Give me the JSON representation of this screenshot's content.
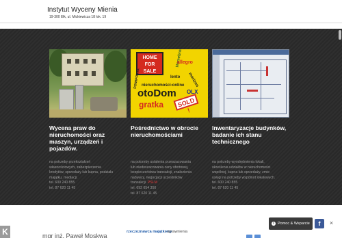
{
  "header": {
    "title": "Instytut Wyceny Mienia",
    "address": "19-300 Ełk, ul. Mickiewicza 18 lok. 19"
  },
  "columns": [
    {
      "title": "Wycena praw do nieruchomości oraz maszyn, urządzeń i pojazdów.",
      "lines": [
        "na potrzeby przekształceń",
        "własnościowych, zabezpieczenia",
        "kredytów, sprzedaży lub kupna, podziału",
        "majątku, mediacji."
      ],
      "phone1": "tel. 600 240 855",
      "phone2": "tel. 87 620 11 45"
    },
    {
      "title": "Pośrednictwo w obrocie nieruchomościami",
      "lines": [
        "na potrzeby ustalenia przeszacowania",
        "lub niedoszacowania ceny ofertowej,",
        "bezpieczeństwa transakcji, znalezienia",
        "nabywcy, negocjacji uczestników"
      ],
      "last_line_prefix": "transakcji.",
      "last_line_highlight": "PSLM",
      "phone1": "tel. 692 654 350",
      "phone2": "tel. 87 620 11 45"
    },
    {
      "title": "Inwentaryzacje budynków, badanie ich stanu technicznego",
      "lines": [
        "na potrzeby wyodrębnienia lokali,",
        "określenia udziałów w nieruchomości",
        "wspólnej, kupna lub sprzedaży, zmie",
        "usługi na potrzeby wspólnot lokalowych."
      ],
      "phone1": "tel. 600 240 855",
      "phone2": "tel. 87 620 11 45"
    }
  ],
  "thumb2_words": {
    "home_sign": [
      "HOME",
      "FOR",
      "SALE"
    ],
    "otodom": "otoDom",
    "gratka": "gratka",
    "olx": "OLX",
    "sold": "SOLD !",
    "nieruchomosci": "nieruchomości-online",
    "domiporta": "DOMIPORTA",
    "allegro": "allegro",
    "lento": "lento",
    "morizon": "morizon",
    "homebroker": "Homebroker"
  },
  "footer": {
    "name": "mgr inż. Paweł Moskwa",
    "link_label": "rzeczoznawca majątkowy",
    "link_rest": "- uprawnienia"
  },
  "badges": {
    "k": "K",
    "help_icon": "i",
    "help_label": "Pomoc & Wsparcie",
    "fb": "f",
    "close": "×"
  },
  "icons": [
    "info-icon",
    "facebook-icon",
    "close-icon",
    "k-logo-icon"
  ]
}
